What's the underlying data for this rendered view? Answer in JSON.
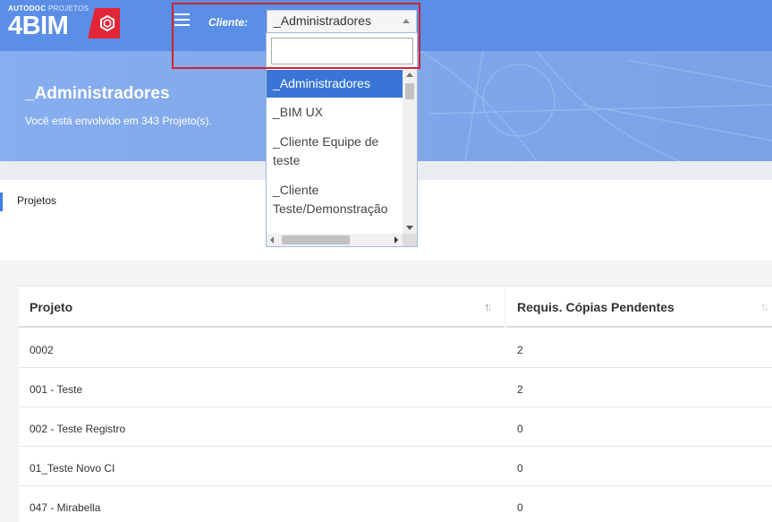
{
  "logo": {
    "small_bold": "AUTODOC",
    "small_thin": "PROJETOS",
    "big": "4BIM"
  },
  "colors": {
    "topbar": "#5b8ee6",
    "accent": "#3875d7",
    "highlight": "#d0232e",
    "badge": "#e32636"
  },
  "header": {
    "cliente_label": "Cliente:"
  },
  "client_select": {
    "value": "_Administradores",
    "search_placeholder": "",
    "options": [
      "_Administradores",
      "_BIM UX",
      "_Cliente Equipe de teste",
      "_Cliente Teste/Demonstração"
    ]
  },
  "banner": {
    "title": "_Administradores",
    "subtitle": "Você está envolvido em 343 Projeto(s)."
  },
  "tabs": [
    {
      "label": "Projetos"
    }
  ],
  "table": {
    "columns": [
      "Projeto",
      "Requis. Cópias Pendentes"
    ],
    "rows": [
      [
        "0002",
        "2"
      ],
      [
        "001 - Teste",
        "2"
      ],
      [
        "002 - Teste Registro",
        "0"
      ],
      [
        "01_Teste Novo CI",
        "0"
      ],
      [
        "047 - Mirabella",
        "0"
      ]
    ]
  }
}
